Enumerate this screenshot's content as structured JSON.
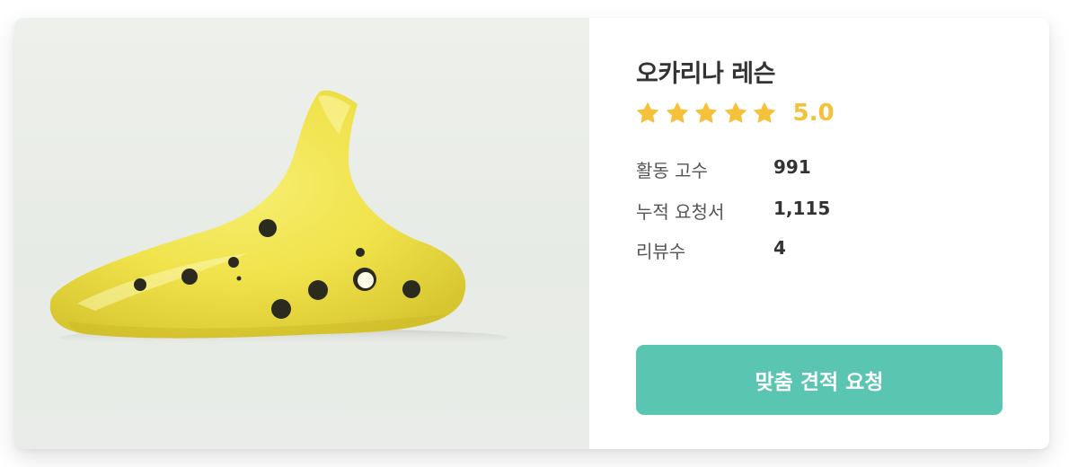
{
  "service": {
    "title": "오카리나 레슨",
    "rating": {
      "star_count": 5,
      "value": "5.0"
    },
    "stats": [
      {
        "label": "활동 고수",
        "value": "991"
      },
      {
        "label": "누적 요청서",
        "value": "1,115"
      },
      {
        "label": "리뷰수",
        "value": "4"
      }
    ],
    "cta_label": "맞춤 견적 요청"
  },
  "theme": {
    "star_color": "#f5c13b",
    "cta_color": "#5ac5b1",
    "text_color": "#333333",
    "subtext_color": "#555555"
  },
  "image": {
    "subject_icon": "ocarina-photo"
  }
}
